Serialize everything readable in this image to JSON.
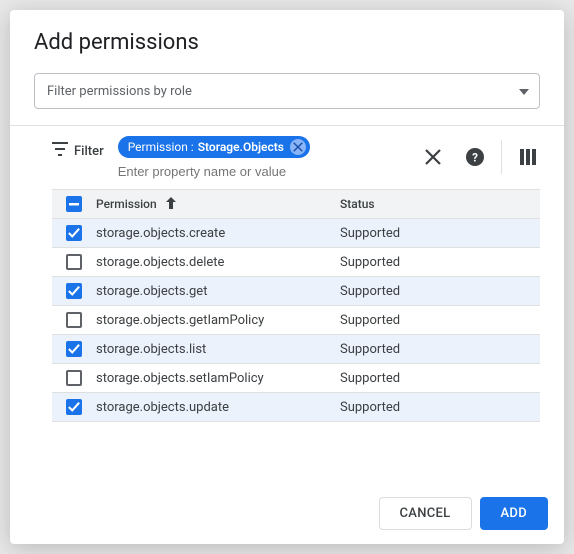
{
  "title": "Add permissions",
  "filter_select": {
    "placeholder": "Filter permissions by role"
  },
  "toolbar": {
    "filter_label": "Filter",
    "chip_key": "Permission : ",
    "chip_value": "Storage.Objects",
    "input_placeholder": "Enter property name or value"
  },
  "columns": {
    "permission": "Permission",
    "status": "Status"
  },
  "rows": [
    {
      "perm": "storage.objects.create",
      "status": "Supported",
      "checked": true
    },
    {
      "perm": "storage.objects.delete",
      "status": "Supported",
      "checked": false
    },
    {
      "perm": "storage.objects.get",
      "status": "Supported",
      "checked": true
    },
    {
      "perm": "storage.objects.getIamPolicy",
      "status": "Supported",
      "checked": false
    },
    {
      "perm": "storage.objects.list",
      "status": "Supported",
      "checked": true
    },
    {
      "perm": "storage.objects.setIamPolicy",
      "status": "Supported",
      "checked": false
    },
    {
      "perm": "storage.objects.update",
      "status": "Supported",
      "checked": true
    }
  ],
  "footer": {
    "cancel": "Cancel",
    "add": "Add"
  }
}
